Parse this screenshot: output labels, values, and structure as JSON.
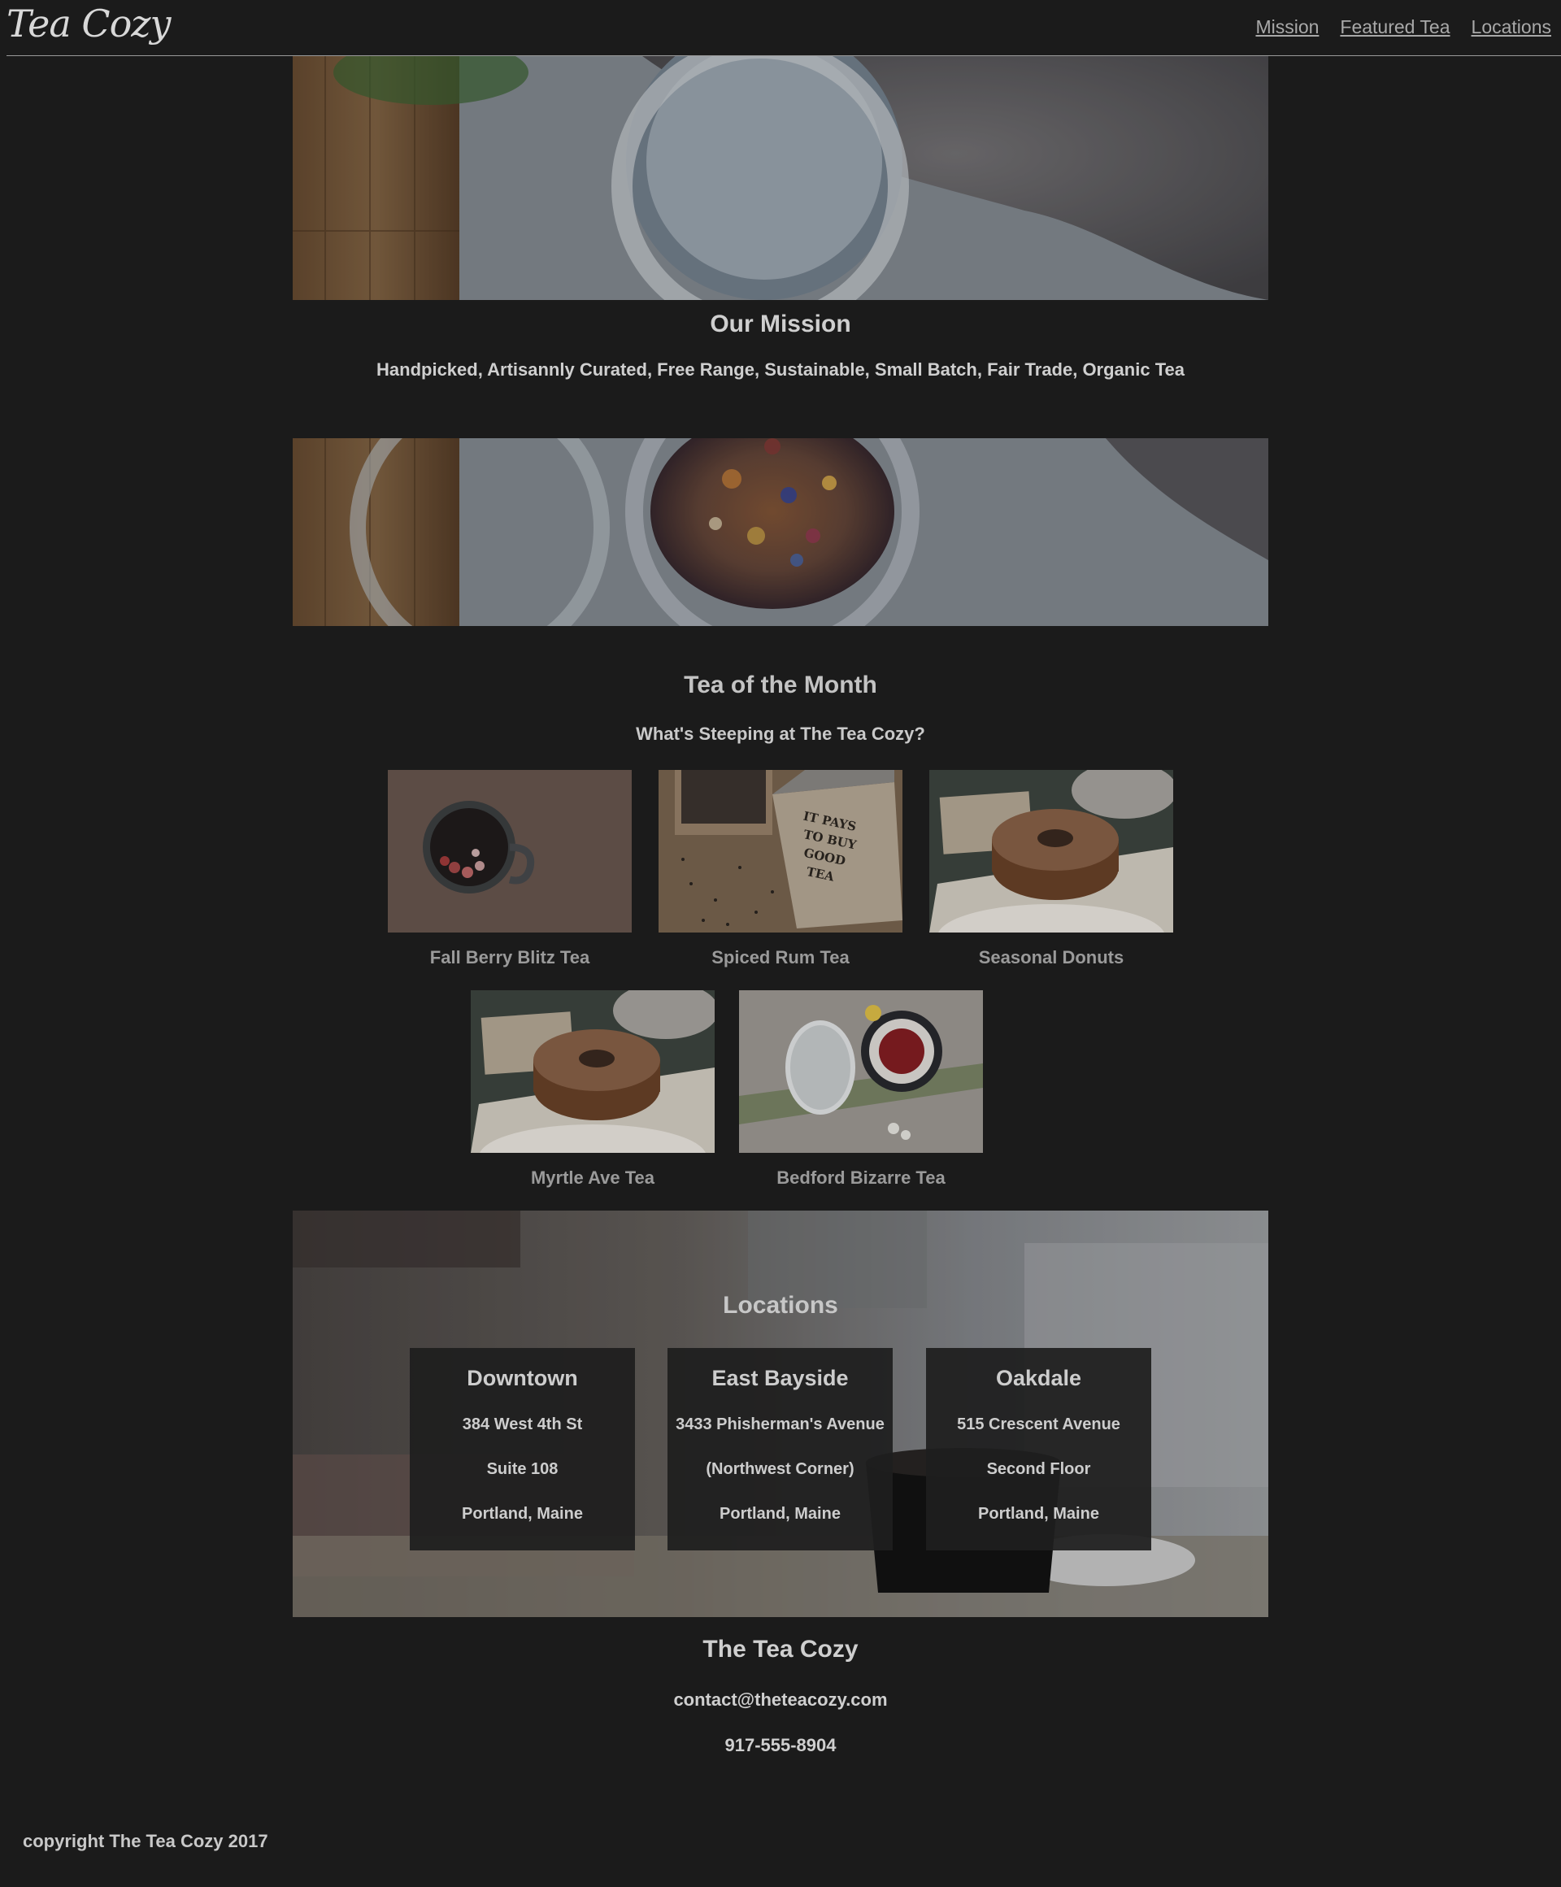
{
  "header": {
    "logo": "Tea Cozy",
    "nav": [
      "Mission",
      "Featured Tea",
      "Locations"
    ]
  },
  "mission": {
    "title": "Our Mission",
    "subtitle": "Handpicked, Artisannly Curated, Free Range, Sustainable, Small Batch, Fair Trade, Organic Tea"
  },
  "tea_of_month": {
    "title": "Tea of the Month",
    "subtitle": "What's Steeping at The Tea Cozy?",
    "items": [
      {
        "name": "Fall Berry Blitz Tea",
        "image": "mug-with-berries"
      },
      {
        "name": "Spiced Rum Tea",
        "image": "good-tea-box"
      },
      {
        "name": "Seasonal Donuts",
        "image": "donut-on-tray"
      },
      {
        "name": "Myrtle Ave Tea",
        "image": "donut-on-tray"
      },
      {
        "name": "Bedford Bizarre Tea",
        "image": "cup-and-jar"
      }
    ],
    "box_text": [
      "IT PAYS",
      "TO BUY",
      "GOOD",
      "TEA"
    ]
  },
  "locations": {
    "title": "Locations",
    "stores": [
      {
        "name": "Downtown",
        "lines": [
          "384 West 4th St",
          "Suite 108",
          "Portland, Maine"
        ]
      },
      {
        "name": "East Bayside",
        "lines": [
          "3433 Phisherman's Avenue",
          "(Northwest Corner)",
          "Portland, Maine"
        ]
      },
      {
        "name": "Oakdale",
        "lines": [
          "515 Crescent Avenue",
          "Second Floor",
          "Portland, Maine"
        ]
      }
    ]
  },
  "footer": {
    "name": "The Tea Cozy",
    "email": "contact@theteacozy.com",
    "phone": "917-555-8904",
    "copyright": "copyright The Tea Cozy 2017"
  },
  "colors": {
    "background": "#1b1b1b",
    "text": "#c8c8c8",
    "link": "#a9a9a9"
  }
}
